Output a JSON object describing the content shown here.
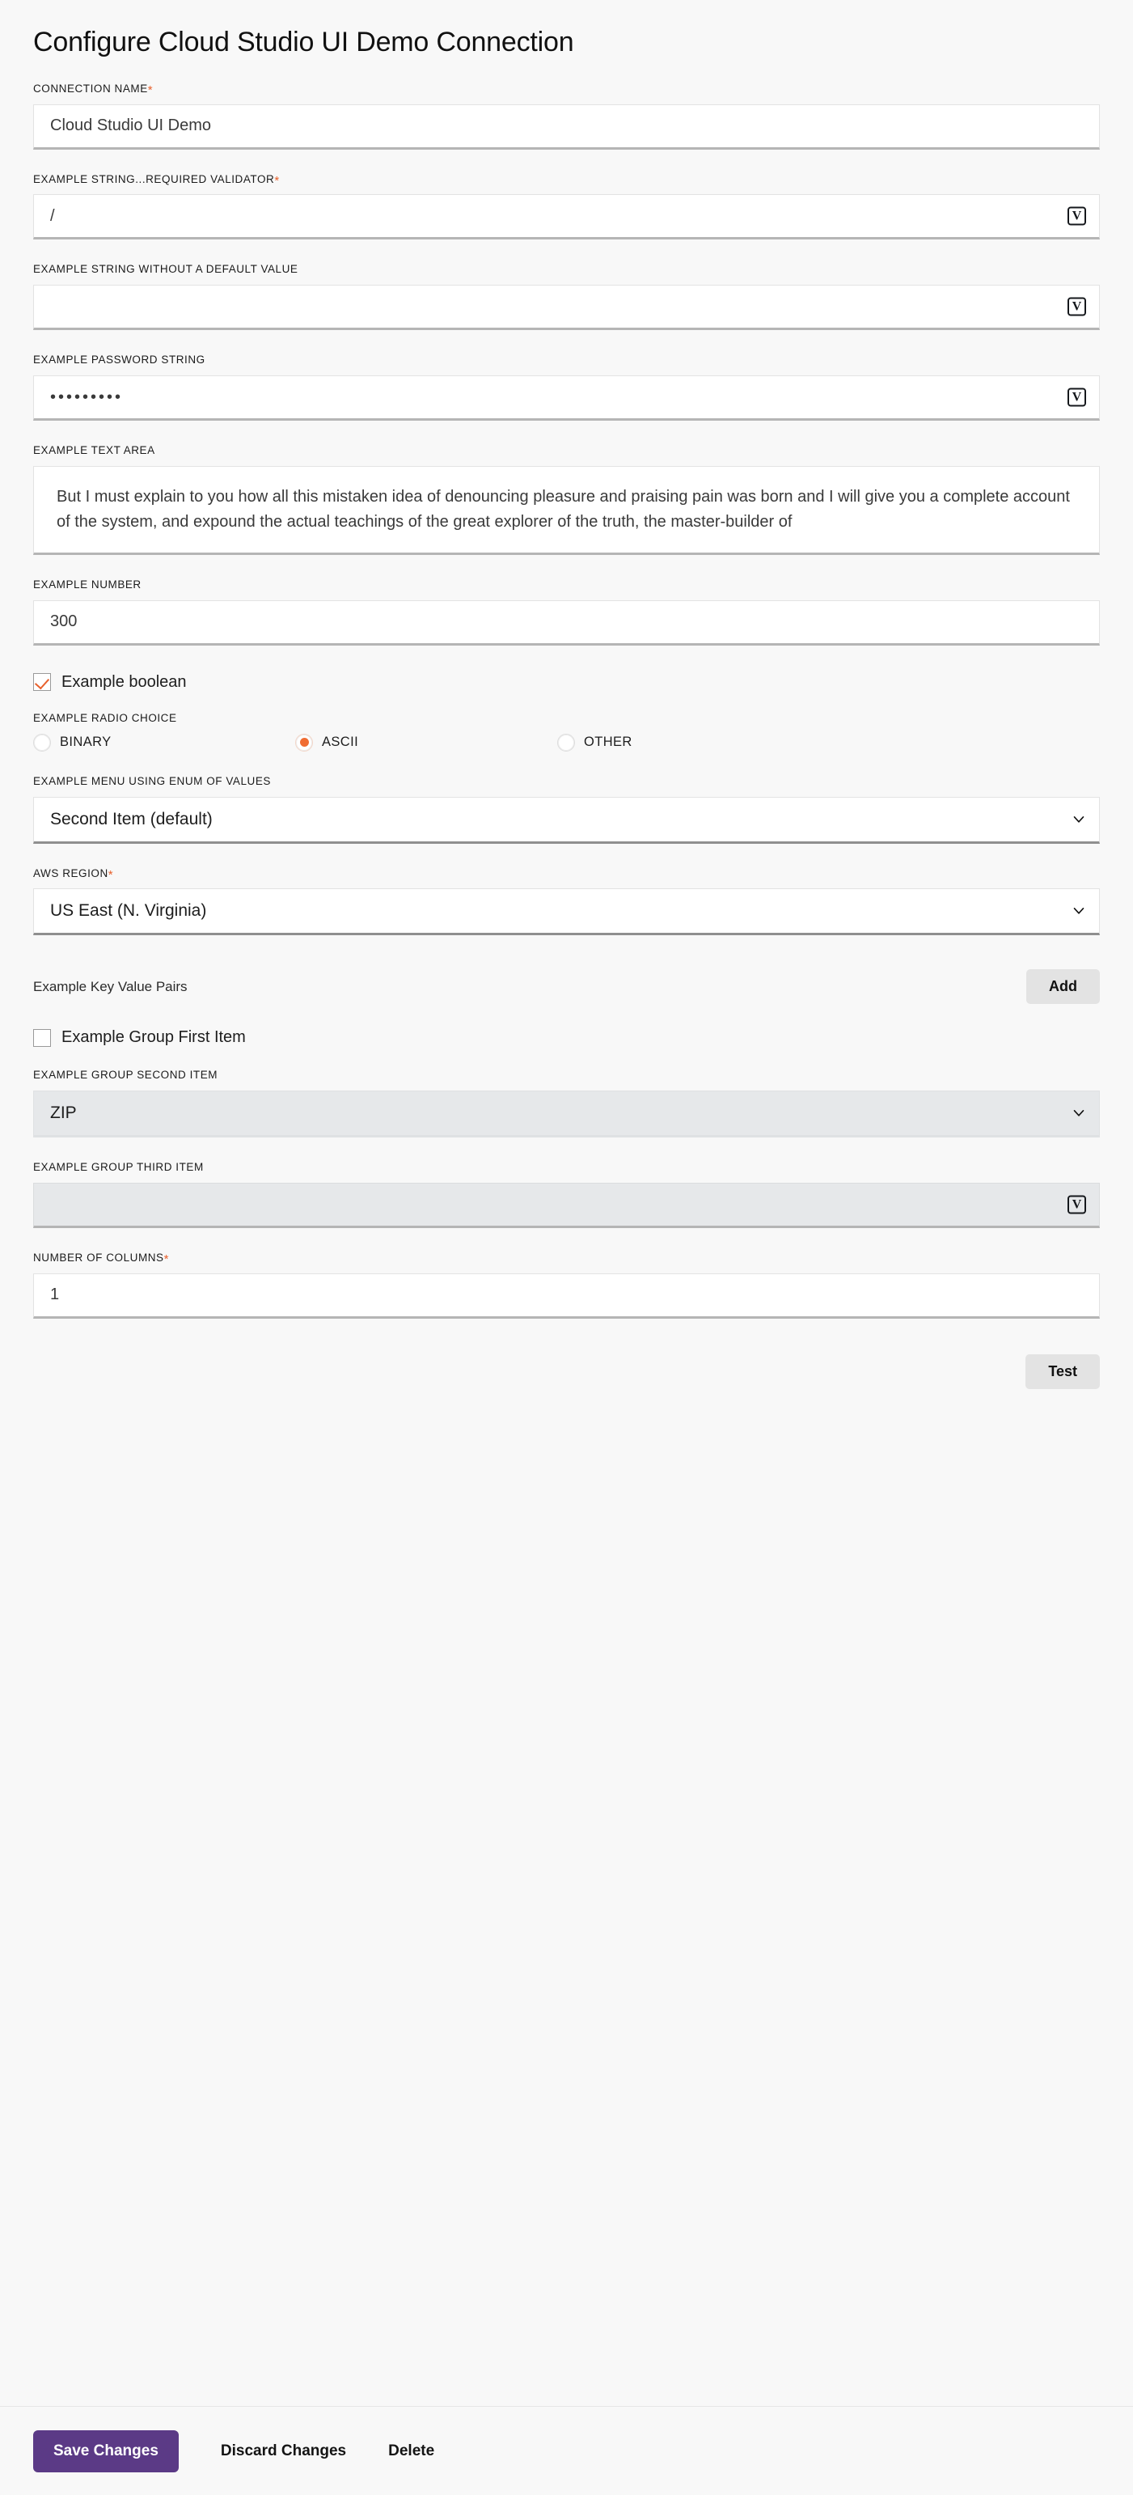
{
  "page": {
    "title": "Configure Cloud Studio UI Demo Connection"
  },
  "colors": {
    "accent_orange": "#f06c32",
    "required_asterisk": "#e8602c",
    "primary_purple": "#5b3a86",
    "page_background": "#f8f8f8",
    "field_background": "#ffffff",
    "disabled_background": "#e6e8ea",
    "grey_button": "#e3e3e3"
  },
  "fields": {
    "connection_name": {
      "label": "CONNECTION NAME",
      "required": true,
      "value": "Cloud Studio UI Demo"
    },
    "example_string_required_validator": {
      "label": "EXAMPLE STRING...REQUIRED VALIDATOR",
      "required": true,
      "value": "/",
      "icon": "variable-icon",
      "icon_glyph": "V"
    },
    "example_string_no_default": {
      "label": "EXAMPLE STRING WITHOUT A DEFAULT VALUE",
      "required": false,
      "value": "",
      "icon": "variable-icon",
      "icon_glyph": "V"
    },
    "example_password_string": {
      "label": "EXAMPLE PASSWORD STRING",
      "required": false,
      "value": "•••••••••",
      "icon": "variable-icon",
      "icon_glyph": "V"
    },
    "example_text_area": {
      "label": "EXAMPLE TEXT AREA",
      "required": false,
      "value": "But I must explain to you how all this mistaken idea of denouncing pleasure and praising pain was born and I will give you a complete account of the system, and expound the actual teachings of the great explorer of the truth, the master-builder of"
    },
    "example_number": {
      "label": "EXAMPLE NUMBER",
      "required": false,
      "value": "300"
    },
    "example_boolean": {
      "label": "Example boolean",
      "checked": true
    },
    "example_radio_choice": {
      "label": "EXAMPLE RADIO CHOICE",
      "options": [
        {
          "label": "BINARY",
          "selected": false
        },
        {
          "label": "ASCII",
          "selected": true
        },
        {
          "label": "OTHER",
          "selected": false
        }
      ]
    },
    "example_menu_enum": {
      "label": "EXAMPLE MENU USING ENUM OF VALUES",
      "required": false,
      "value": "Second Item (default)"
    },
    "aws_region": {
      "label": "AWS REGION",
      "required": true,
      "value": "US East (N. Virginia)"
    },
    "example_key_value_pairs": {
      "label": "Example Key Value Pairs",
      "add_button": "Add"
    },
    "example_group_first_item": {
      "label": "Example Group First Item",
      "checked": false
    },
    "example_group_second_item": {
      "label": "EXAMPLE GROUP SECOND ITEM",
      "required": false,
      "value": "ZIP",
      "disabled": true
    },
    "example_group_third_item": {
      "label": "EXAMPLE GROUP THIRD ITEM",
      "required": false,
      "value": "",
      "disabled": true,
      "icon": "variable-icon",
      "icon_glyph": "V"
    },
    "number_of_columns": {
      "label": "NUMBER OF COLUMNS",
      "required": true,
      "value": "1"
    }
  },
  "actions": {
    "test": "Test",
    "save": "Save Changes",
    "discard": "Discard Changes",
    "delete": "Delete"
  },
  "symbols": {
    "asterisk": "*"
  }
}
